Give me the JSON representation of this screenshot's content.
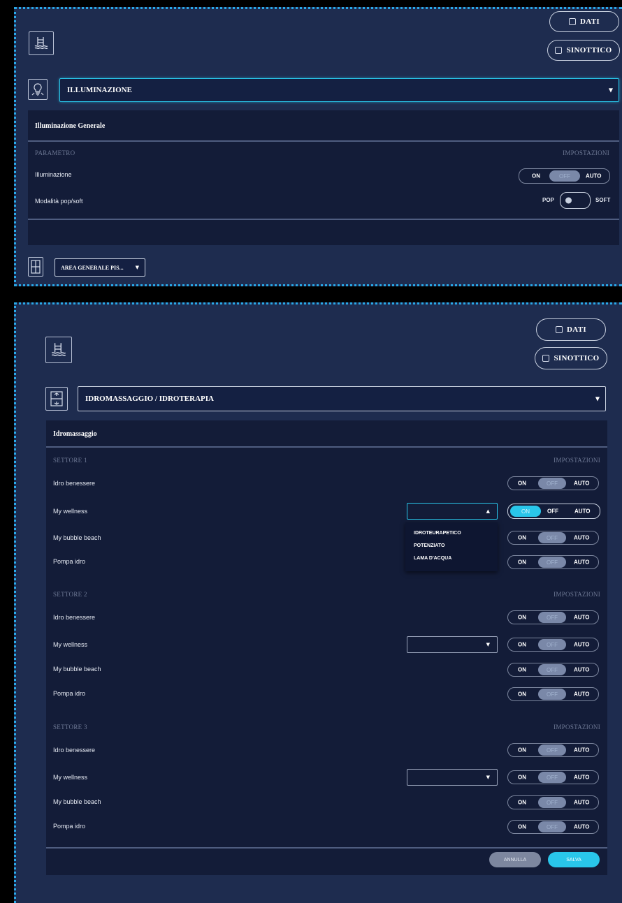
{
  "header_buttons": {
    "dati": "DATI",
    "sinottico": "SINOTTICO"
  },
  "panel1": {
    "category_select": "ILLUMINAZIONE",
    "title": "Illuminazione Generale",
    "col_left": "PARAMETRO",
    "col_right": "IMPOSTAZIONI",
    "rows": [
      {
        "label": "Illuminazione",
        "on": "ON",
        "off": "OFF",
        "auto": "AUTO"
      },
      {
        "label": "Modalità pop/soft",
        "left": "POP",
        "right": "SOFT"
      }
    ],
    "area_select": "AREA GENERALE PIS..."
  },
  "panel2": {
    "category_select": "IDROMASSAGGIO / IDROTERAPIA",
    "title": "Idromassaggio",
    "col_right": "IMPOSTAZIONI",
    "sectors": [
      {
        "name": "SETTORE 1",
        "rows": [
          "Idro benessere",
          "My wellness",
          "My bubble beach",
          "Pompa idro"
        ]
      },
      {
        "name": "SETTORE 2",
        "rows": [
          "Idro benessere",
          "My wellness",
          "My bubble beach",
          "Pompa idro"
        ]
      },
      {
        "name": "SETTORE 3",
        "rows": [
          "Idro benessere",
          "My wellness",
          "My bubble beach",
          "Pompa idro"
        ]
      }
    ],
    "toggle": {
      "on": "ON",
      "off": "OFF",
      "auto": "AUTO"
    },
    "dropdown_options": [
      "IDROTEURAPETICO",
      "POTENZIATO",
      "LAMA D'ACQUA"
    ],
    "cancel": "ANNULLA",
    "save": "SALVA"
  },
  "icons": {
    "pool": "pool-icon",
    "light": "lightbulb-icon",
    "hydro": "hydromassage-icon",
    "area": "area-icon",
    "chart": "chart-icon",
    "list": "list-icon"
  },
  "colors": {
    "accent": "#29c6ea",
    "background": "#1e2c4f",
    "panel": "#131c38"
  }
}
